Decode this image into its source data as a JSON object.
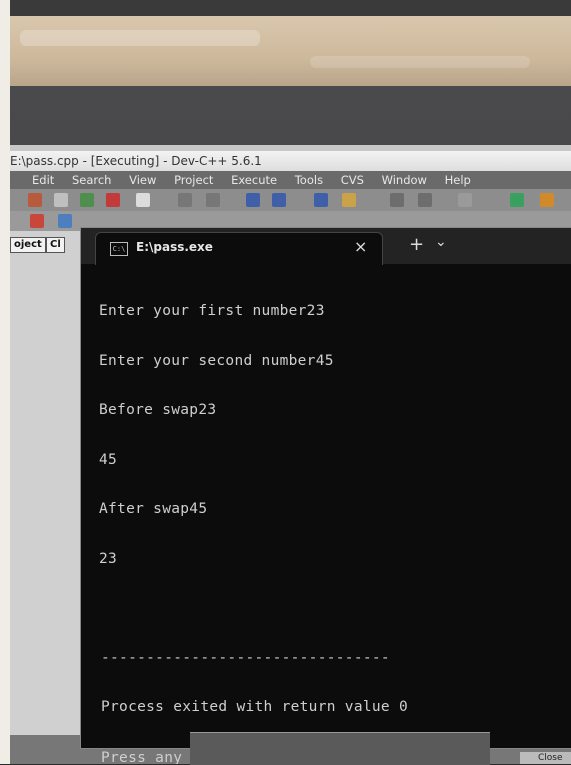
{
  "ide": {
    "title": "E:\\pass.cpp - [Executing] - Dev-C++ 5.6.1",
    "menu": [
      "Edit",
      "Search",
      "View",
      "Project",
      "Execute",
      "Tools",
      "CVS",
      "Window",
      "Help"
    ],
    "panel_tabs": [
      "oject",
      "Cl"
    ]
  },
  "console": {
    "tab_title": "E:\\pass.exe",
    "tab_icon_text": "C:\\",
    "close_glyph": "×",
    "newtab_glyph": "+",
    "dropdown_glyph": "⌄",
    "lines": [
      "Enter your first number23",
      "Enter your second number45",
      "Before swap23",
      "45",
      "After swap45",
      "23",
      "",
      "--------------------------------",
      "Process exited with return value 0",
      "Press any key to continue . . ."
    ]
  },
  "taskbar": {
    "corner_label": "Close"
  },
  "colors": {
    "console_bg": "#0c0c0c",
    "console_text": "#cfcfcf",
    "menubar_bg": "#6a6a6a"
  }
}
